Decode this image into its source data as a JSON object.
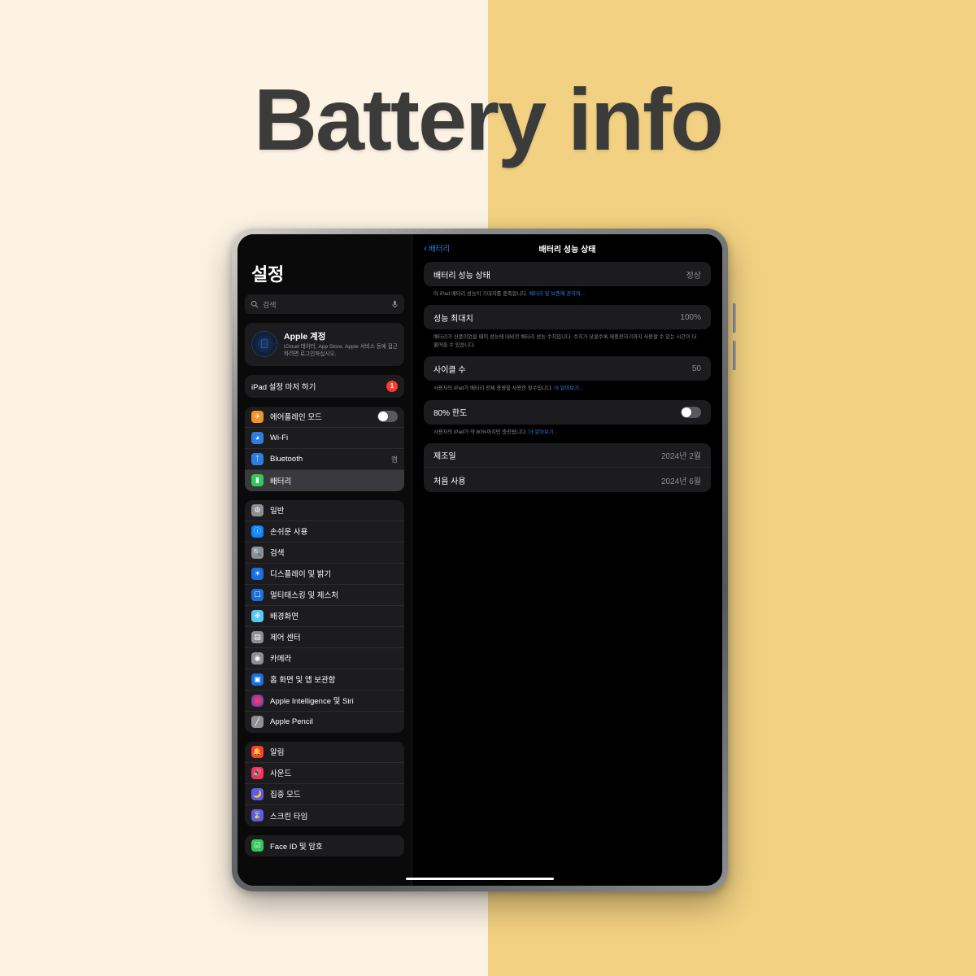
{
  "headline": "Battery info",
  "theme": {
    "bg_left": "#fdf3e5",
    "bg_right": "#f2d182",
    "headline_color": "#3b3b39",
    "accent_blue": "#2f7de1",
    "badge_red": "#ff3b30"
  },
  "sidebar": {
    "title": "설정",
    "search": {
      "placeholder": "검색",
      "search_icon": "search-icon",
      "mic_icon": "microphone-icon"
    },
    "account": {
      "title": "Apple 계정",
      "subtitle": "iCloud 데이터, App Store, Apple 서비스 등에 접근하려면 로그인하십시오."
    },
    "setup_row": {
      "label": "iPad 설정 마저 하기",
      "badge": "1"
    },
    "group_connectivity": [
      {
        "label": "에어플레인 모드",
        "icon": "airplane-icon",
        "icon_color": "#f0952a",
        "control": "toggle",
        "toggle_on": false
      },
      {
        "label": "Wi-Fi",
        "icon": "wifi-icon",
        "icon_color": "#2f7de1",
        "value": ""
      },
      {
        "label": "Bluetooth",
        "icon": "bluetooth-icon",
        "icon_color": "#2f7de1",
        "value": "켬"
      },
      {
        "label": "배터리",
        "icon": "battery-icon",
        "icon_color": "#34c759",
        "value": "",
        "selected": true
      }
    ],
    "group_general": [
      {
        "label": "일반",
        "icon": "gear-icon",
        "icon_color": "#8e8e93"
      },
      {
        "label": "손쉬운 사용",
        "icon": "accessibility-icon",
        "icon_color": "#0a84ff"
      },
      {
        "label": "검색",
        "icon": "search-icon",
        "icon_color": "#8e8e93"
      },
      {
        "label": "디스플레이 및 밝기",
        "icon": "brightness-icon",
        "icon_color": "#1a6fe0"
      },
      {
        "label": "멀티태스킹 및 제스처",
        "icon": "multitasking-icon",
        "icon_color": "#1a6fe0"
      },
      {
        "label": "배경화면",
        "icon": "wallpaper-icon",
        "icon_color": "#5ac8f5"
      },
      {
        "label": "제어 센터",
        "icon": "control-center-icon",
        "icon_color": "#8e8e93"
      },
      {
        "label": "카메라",
        "icon": "camera-icon",
        "icon_color": "#8e8e93"
      },
      {
        "label": "홈 화면 및 앱 보관함",
        "icon": "home-screen-icon",
        "icon_color": "#1a6fe0"
      },
      {
        "label": "Apple Intelligence 및 Siri",
        "icon": "siri-icon",
        "icon_color": "#1c1c1e"
      },
      {
        "label": "Apple Pencil",
        "icon": "pencil-icon",
        "icon_color": "#8e8e93"
      }
    ],
    "group_alerts": [
      {
        "label": "알림",
        "icon": "bell-icon",
        "icon_color": "#ff3b30"
      },
      {
        "label": "사운드",
        "icon": "speaker-icon",
        "icon_color": "#ff2d55"
      },
      {
        "label": "집중 모드",
        "icon": "moon-icon",
        "icon_color": "#5e5ce6"
      },
      {
        "label": "스크린 타임",
        "icon": "hourglass-icon",
        "icon_color": "#5e5ce6"
      }
    ],
    "group_security": [
      {
        "label": "Face ID 및 암호",
        "icon": "faceid-icon",
        "icon_color": "#34c759"
      }
    ]
  },
  "detail": {
    "back_label": "배터리",
    "title": "배터리 성능 상태",
    "card_health": [
      {
        "key": "배터리 성능 상태",
        "value": "정상"
      }
    ],
    "footnote_health_text": "이 iPad 배터리 성능이 기대치를 충족합니다. ",
    "footnote_health_link": "배터리 및 보증에 관하여...",
    "card_capacity": [
      {
        "key": "성능 최대치",
        "value": "100%"
      }
    ],
    "footnote_capacity": "배터리가 신품이었을 때의 성능에 대비한 배터리 성능 수치입니다. 수치가 낮을수록 재충전하기까지 사용할 수 있는 시간이 더 줄어들 수 있습니다.",
    "card_cycles": [
      {
        "key": "사이클 수",
        "value": "50"
      }
    ],
    "footnote_cycles_text": "사용자의 iPad가 배터리 전체 용량을 사용한 횟수입니다. ",
    "footnote_cycles_link": "더 알아보기...",
    "card_limit": {
      "key": "80% 한도",
      "toggle_on": false
    },
    "footnote_limit_text": "사용자의 iPad가 약 80%까지만 충전됩니다. ",
    "footnote_limit_link": "더 알아보기...",
    "card_dates": [
      {
        "key": "제조일",
        "value": "2024년 2월"
      },
      {
        "key": "처음 사용",
        "value": "2024년 6월"
      }
    ]
  }
}
